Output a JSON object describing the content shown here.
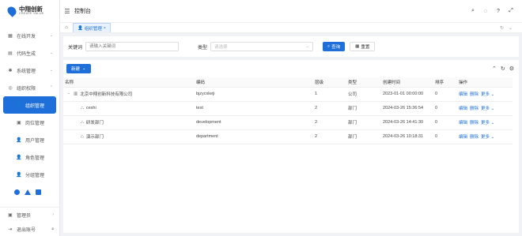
{
  "brand": {
    "name_cn": "中翔创新",
    "name_en": "CREATE VALUE"
  },
  "sidebar": {
    "menus": [
      {
        "label": "在线开发",
        "icon": "dev-icon"
      },
      {
        "label": "代码生成",
        "icon": "code-icon"
      },
      {
        "label": "系统管理",
        "icon": "system-icon"
      },
      {
        "label": "组织权限",
        "icon": "org-icon"
      }
    ],
    "sub_items": [
      {
        "label": "组织管理",
        "active": true
      },
      {
        "label": "岗位管理",
        "active": false
      },
      {
        "label": "用户管理",
        "active": false
      },
      {
        "label": "角色管理",
        "active": false
      },
      {
        "label": "分组管理",
        "active": false
      }
    ],
    "bottom": [
      {
        "label": "管理员"
      },
      {
        "label": "退出账号"
      }
    ]
  },
  "header": {
    "title": "控制台"
  },
  "tabs": [
    {
      "label": "组织管理"
    }
  ],
  "search": {
    "keyword_label": "关键词",
    "keyword_placeholder": "请输入关键词",
    "type_label": "类型",
    "type_placeholder": "请选择",
    "search_btn": "查询",
    "reset_btn": "重置"
  },
  "toolbar": {
    "new_btn": "新建"
  },
  "table": {
    "columns": [
      "名称",
      "编码",
      "层级",
      "类型",
      "创建时间",
      "排序",
      "操作"
    ],
    "rows": [
      {
        "name": "北京中翔创新科技有限公司",
        "code": "bjzycxkeji",
        "level": "1",
        "type": "公司",
        "created": "2023-01-01 00:00:00",
        "sort": "0",
        "child": false
      },
      {
        "name": "ceshi",
        "code": "test",
        "level": "2",
        "type": "部门",
        "created": "2024-03-26 15:36:54",
        "sort": "0",
        "child": true
      },
      {
        "name": "研发部门",
        "code": "development",
        "level": "2",
        "type": "部门",
        "created": "2024-03-26 14:41:30",
        "sort": "0",
        "child": true
      },
      {
        "name": "演示部门",
        "code": "department",
        "level": "2",
        "type": "部门",
        "created": "2024-03-26 10:18:31",
        "sort": "0",
        "child": true
      }
    ],
    "ops": [
      "编辑",
      "删除",
      "更多"
    ]
  },
  "colors": {
    "accent": "#1e6fd9"
  }
}
